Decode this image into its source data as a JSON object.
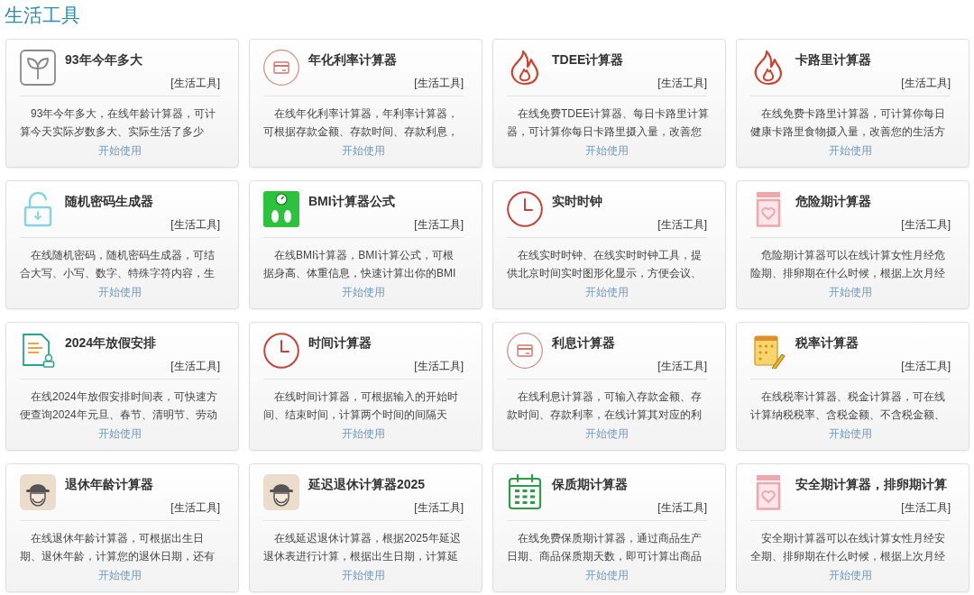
{
  "section": {
    "heading": "生活工具"
  },
  "tools": [
    {
      "kind": "sprout",
      "title": "93年今年多大",
      "tag": "[生活工具]",
      "description": [
        "93年今年多大，在线年龄计算器，可计",
        "算今天实际岁数多大、实际生活了多少"
      ],
      "link": "开始使用"
    },
    {
      "kind": "card",
      "title": "年化利率计算器",
      "tag": "[生活工具]",
      "description": [
        "在线年化利率计算器，年利率计算器，",
        "可根据存款金额、存款时间、存款利息，"
      ],
      "link": "开始使用"
    },
    {
      "kind": "flame",
      "title": "TDEE计算器",
      "tag": "[生活工具]",
      "description": [
        "在线免费TDEE计算器、每日卡路里计算",
        "器，可计算你每日卡路里摄入量，改善您"
      ],
      "link": "开始使用"
    },
    {
      "kind": "flame",
      "title": "卡路里计算器",
      "tag": "[生活工具]",
      "description": [
        "在线免费卡路里计算器，可计算你每日",
        "健康卡路里食物摄入量，改善您的生活方"
      ],
      "link": "开始使用"
    },
    {
      "kind": "lock",
      "title": "随机密码生成器",
      "tag": "[生活工具]",
      "description": [
        "在线随机密码，随机密码生成器，可结",
        "合大写、小写、数字、特殊字符内容，生"
      ],
      "link": "开始使用"
    },
    {
      "kind": "scale",
      "title": "BMI计算器公式",
      "tag": "[生活工具]",
      "description": [
        "在线BMI计算器，BMI计算公式，可根",
        "据身高、体重信息，快速计算出你的BMI"
      ],
      "link": "开始使用"
    },
    {
      "kind": "clock",
      "title": "实时时钟",
      "tag": "[生活工具]",
      "description": [
        "在线实时时钟、在线实时时钟工具，提",
        "供北京时间实时图形化显示，方便会议、"
      ],
      "link": "开始使用"
    },
    {
      "kind": "jar",
      "title": "危险期计算器",
      "tag": "[生活工具]",
      "description": [
        "危险期计算器可以在线计算女性月经危",
        "险期、排卵期在什么时候，根据上次月经"
      ],
      "link": "开始使用"
    },
    {
      "kind": "document",
      "title": "2024年放假安排",
      "tag": "[生活工具]",
      "description": [
        "在线2024年放假安排时间表，可快速方",
        "便查询2024年元旦、春节、清明节、劳动"
      ],
      "link": "开始使用"
    },
    {
      "kind": "clock",
      "title": "时间计算器",
      "tag": "[生活工具]",
      "description": [
        "在线时间计算器，可根据输入的开始时",
        "间、结束时间，计算两个时间的间隔天"
      ],
      "link": "开始使用"
    },
    {
      "kind": "card",
      "title": "利息计算器",
      "tag": "[生活工具]",
      "description": [
        "在线利息计算器，可输入存款金额、存",
        "款时间、存款利率，在线计算其对应的利"
      ],
      "link": "开始使用"
    },
    {
      "kind": "notepad",
      "title": "税率计算器",
      "tag": "[生活工具]",
      "description": [
        "在线税率计算器、税金计算器，可在线",
        "计算纳税税率、含税金额、不含税金额、"
      ],
      "link": "开始使用"
    },
    {
      "kind": "elder",
      "title": "退休年龄计算器",
      "tag": "[生活工具]",
      "description": [
        "在线退休年龄计算器，可根据出生日",
        "期、退休年龄，计算您的退休日期，还有"
      ],
      "link": "开始使用"
    },
    {
      "kind": "elder",
      "title": "延迟退休计算器2025",
      "tag": "[生活工具]",
      "description": [
        "在线延迟退休计算器，根据2025年延迟",
        "退休表进行计算，根据出生日期，计算延"
      ],
      "link": "开始使用"
    },
    {
      "kind": "calendar",
      "title": "保质期计算器",
      "tag": "[生活工具]",
      "description": [
        "在线免费保质期计算器，通过商品生产",
        "日期、商品保质期天数，即可计算出商品"
      ],
      "link": "开始使用"
    },
    {
      "kind": "jar",
      "title": "安全期计算器，排卵期计算",
      "tag": "[生活工具]",
      "description": [
        "安全期计算器可以在线计算女性月经安",
        "全期、排卵期在什么时候，根据上次月经"
      ],
      "link": "开始使用"
    }
  ]
}
